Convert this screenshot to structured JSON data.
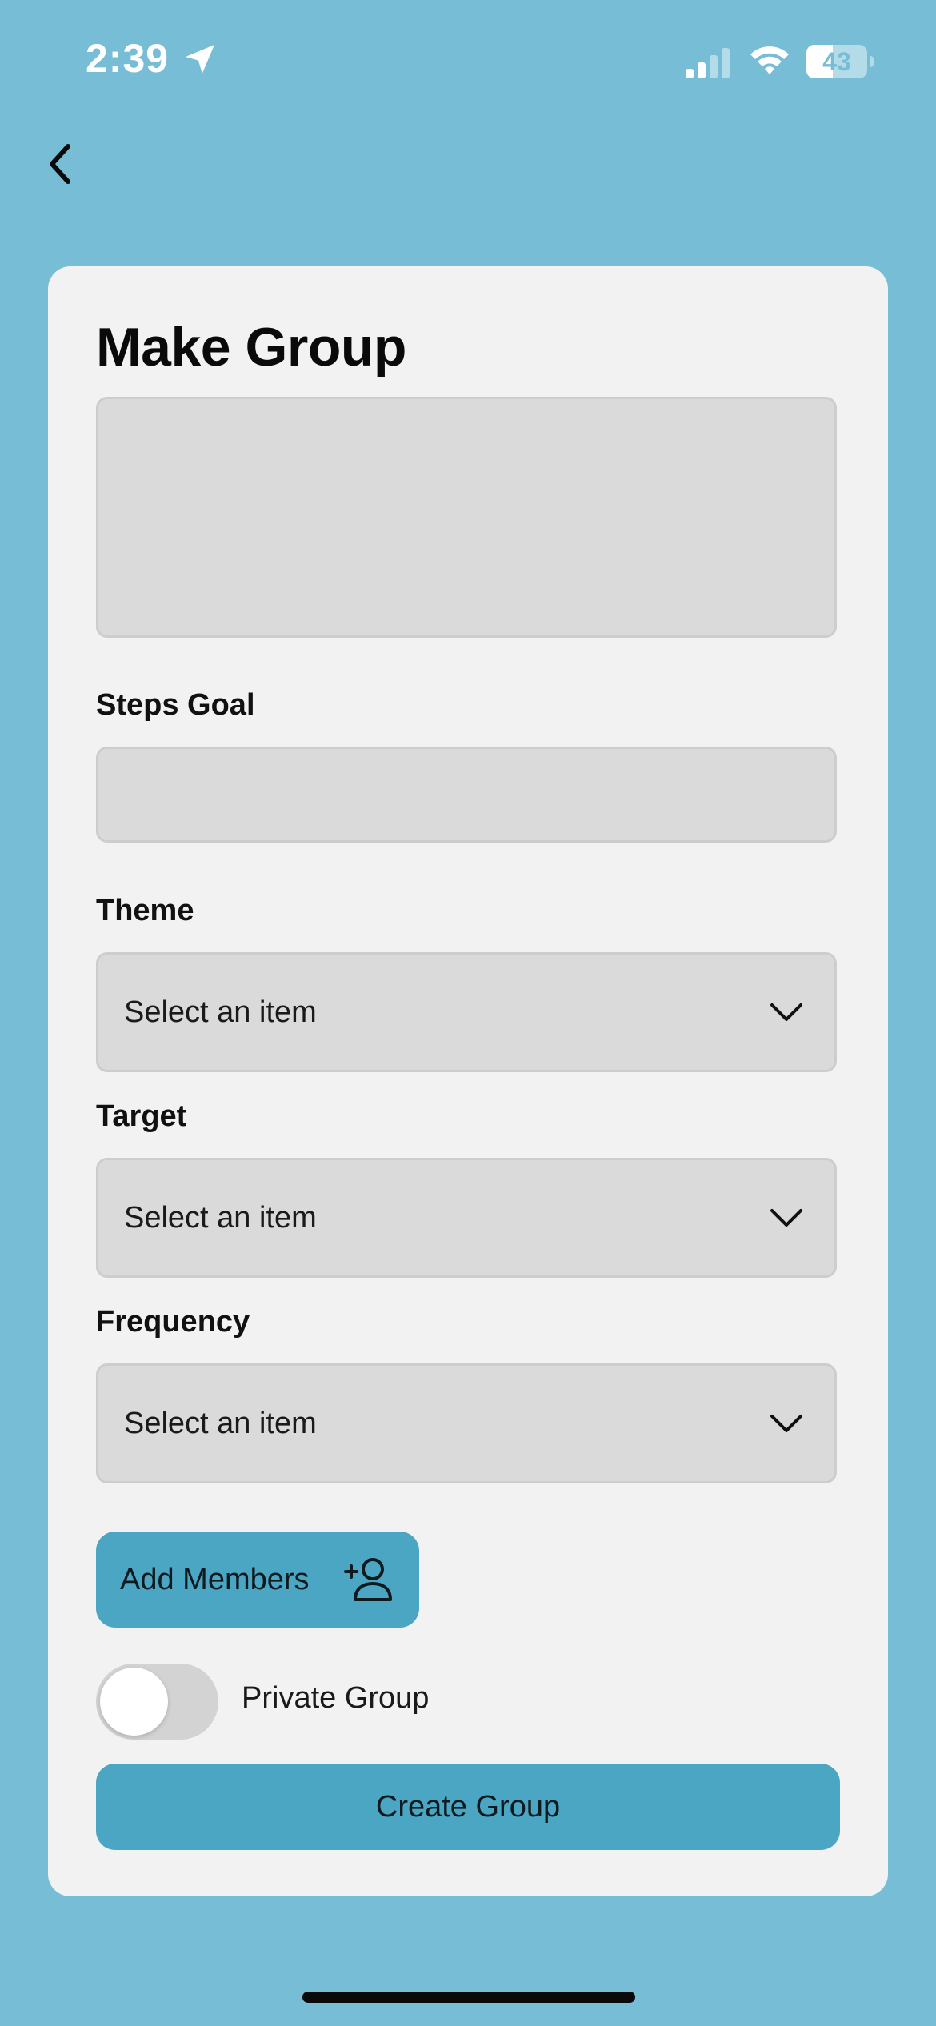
{
  "status_bar": {
    "time": "2:39",
    "battery": "43",
    "battery_level": 0.43,
    "signal_bars_active": 2,
    "icons": [
      "location-arrow-icon",
      "cellular-signal-icon",
      "wifi-icon",
      "battery-icon"
    ]
  },
  "nav": {
    "back_icon": "chevron-left-icon"
  },
  "form": {
    "title": "Make Group",
    "steps_goal_label": "Steps Goal",
    "theme": {
      "label": "Theme",
      "value": "Select an item"
    },
    "target": {
      "label": "Target",
      "value": "Select an item"
    },
    "frequency": {
      "label": "Frequency",
      "value": "Select an item"
    },
    "add_members_label": "Add Members",
    "add_members_icon": "add-user-icon",
    "private_group_label": "Private Group",
    "private_group_on": false,
    "create_label": "Create Group"
  },
  "colors": {
    "background": "#76bdd5",
    "card": "#f2f2f2",
    "field": "#dadada",
    "button": "#4aa6c3"
  }
}
